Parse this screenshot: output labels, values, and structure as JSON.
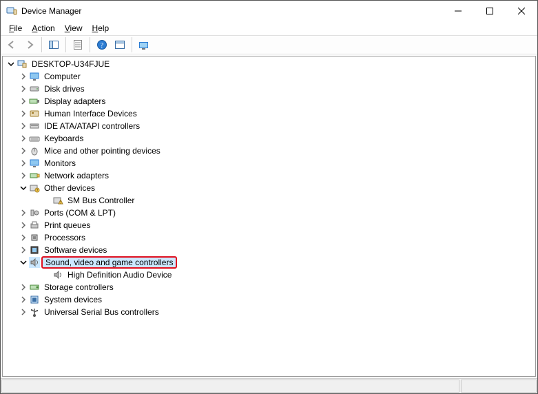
{
  "window": {
    "title": "Device Manager"
  },
  "menu": {
    "file": "File",
    "action": "Action",
    "view": "View",
    "help": "Help"
  },
  "toolbar": {
    "back": "Back",
    "forward": "Forward",
    "show_hide_tree": "Show/Hide Console Tree",
    "properties": "Properties",
    "help": "Help",
    "show_hidden": "Show hidden devices",
    "scan": "Scan for hardware changes"
  },
  "tree": {
    "root": "DESKTOP-U34FJUE",
    "categories": [
      {
        "label": "Computer",
        "icon": "monitor",
        "expanded": false
      },
      {
        "label": "Disk drives",
        "icon": "disk",
        "expanded": false
      },
      {
        "label": "Display adapters",
        "icon": "display-adapter",
        "expanded": false
      },
      {
        "label": "Human Interface Devices",
        "icon": "hid",
        "expanded": false
      },
      {
        "label": "IDE ATA/ATAPI controllers",
        "icon": "ide",
        "expanded": false
      },
      {
        "label": "Keyboards",
        "icon": "keyboard",
        "expanded": false
      },
      {
        "label": "Mice and other pointing devices",
        "icon": "mouse",
        "expanded": false
      },
      {
        "label": "Monitors",
        "icon": "monitor",
        "expanded": false
      },
      {
        "label": "Network adapters",
        "icon": "network",
        "expanded": false
      },
      {
        "label": "Other devices",
        "icon": "other",
        "expanded": true,
        "children": [
          {
            "label": "SM Bus Controller",
            "icon": "other-warn"
          }
        ]
      },
      {
        "label": "Ports (COM & LPT)",
        "icon": "port",
        "expanded": false
      },
      {
        "label": "Print queues",
        "icon": "printer",
        "expanded": false
      },
      {
        "label": "Processors",
        "icon": "cpu",
        "expanded": false
      },
      {
        "label": "Software devices",
        "icon": "software",
        "expanded": false
      },
      {
        "label": "Sound, video and game controllers",
        "icon": "sound",
        "expanded": true,
        "highlighted": true,
        "selected": true,
        "children": [
          {
            "label": "High Definition Audio Device",
            "icon": "sound"
          }
        ]
      },
      {
        "label": "Storage controllers",
        "icon": "storage",
        "expanded": false
      },
      {
        "label": "System devices",
        "icon": "system",
        "expanded": false
      },
      {
        "label": "Universal Serial Bus controllers",
        "icon": "usb",
        "expanded": false
      }
    ]
  }
}
